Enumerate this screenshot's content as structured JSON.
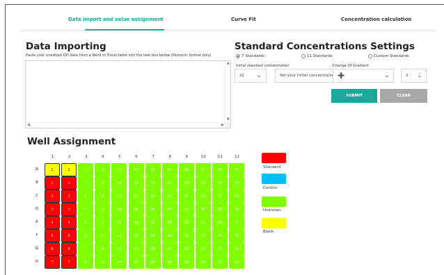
{
  "tabs": [
    {
      "label": "Data import and value assignment",
      "active": true
    },
    {
      "label": "Curve Fit",
      "active": false
    },
    {
      "label": "Concentration calculation",
      "active": false
    }
  ],
  "importing": {
    "title": "Data Importing",
    "instructions": "Paste your unedited OD data from a Word or Excel table into the text box below (Numeric format only)",
    "textarea_value": ""
  },
  "settings": {
    "title": "Standard Concentrations Settings",
    "radios": [
      {
        "label": "7 Standards",
        "checked": true
      },
      {
        "label": "11 Standards",
        "checked": false
      },
      {
        "label": "Custom Standards",
        "checked": false
      }
    ],
    "initial_label": "Initial standard concentration",
    "multiplier_value": "x1",
    "concentration_placeholder": "Set your initial concentration!",
    "gradient_label": "Change Of Gradient",
    "gradient_op": "✚",
    "gradient_value": "2",
    "submit_label": "SUBMIT",
    "clear_label": "CLEAR"
  },
  "well": {
    "title": "Well Assignment",
    "columns": [
      "1",
      "2",
      "3",
      "4",
      "5",
      "6",
      "7",
      "8",
      "9",
      "10",
      "11",
      "12"
    ],
    "rows": [
      {
        "label": "A",
        "cells": [
          "1",
          "1",
          "1",
          "9",
          "17",
          "25",
          "33",
          "41",
          "49",
          "57",
          "65",
          "73"
        ],
        "colors": [
          "Y",
          "Y",
          "G",
          "G",
          "G",
          "G",
          "G",
          "G",
          "G",
          "G",
          "G",
          "G"
        ]
      },
      {
        "label": "B",
        "cells": [
          "1",
          "1",
          "2",
          "10",
          "18",
          "26",
          "34",
          "42",
          "50",
          "58",
          "66",
          "74"
        ],
        "colors": [
          "R",
          "R",
          "G",
          "G",
          "G",
          "G",
          "G",
          "G",
          "G",
          "G",
          "G",
          "G"
        ]
      },
      {
        "label": "C",
        "cells": [
          "2",
          "2",
          "3",
          "11",
          "19",
          "27",
          "35",
          "43",
          "51",
          "59",
          "67",
          "75"
        ],
        "colors": [
          "R",
          "R",
          "G",
          "G",
          "G",
          "G",
          "G",
          "G",
          "G",
          "G",
          "G",
          "G"
        ]
      },
      {
        "label": "D",
        "cells": [
          "3",
          "3",
          "4",
          "12",
          "20",
          "28",
          "36",
          "44",
          "52",
          "60",
          "68",
          "76"
        ],
        "colors": [
          "R",
          "R",
          "G",
          "G",
          "G",
          "G",
          "G",
          "G",
          "G",
          "G",
          "G",
          "G"
        ]
      },
      {
        "label": "E",
        "cells": [
          "4",
          "4",
          "5",
          "13",
          "21",
          "29",
          "37",
          "45",
          "53",
          "61",
          "69",
          "77"
        ],
        "colors": [
          "R",
          "R",
          "G",
          "G",
          "G",
          "G",
          "G",
          "G",
          "G",
          "G",
          "G",
          "G"
        ]
      },
      {
        "label": "F",
        "cells": [
          "5",
          "5",
          "6",
          "14",
          "22",
          "30",
          "38",
          "46",
          "54",
          "62",
          "70",
          "78"
        ],
        "colors": [
          "R",
          "R",
          "G",
          "G",
          "G",
          "G",
          "G",
          "G",
          "G",
          "G",
          "G",
          "G"
        ]
      },
      {
        "label": "G",
        "cells": [
          "6",
          "6",
          "7",
          "15",
          "23",
          "31",
          "39",
          "47",
          "55",
          "63",
          "71",
          "79"
        ],
        "colors": [
          "R",
          "R",
          "G",
          "G",
          "G",
          "G",
          "G",
          "G",
          "G",
          "G",
          "G",
          "G"
        ]
      },
      {
        "label": "H",
        "cells": [
          "7",
          "7",
          "8",
          "16",
          "24",
          "32",
          "40",
          "48",
          "56",
          "64",
          "72",
          "80"
        ],
        "colors": [
          "R",
          "R",
          "G",
          "G",
          "G",
          "G",
          "G",
          "G",
          "G",
          "G",
          "G",
          "G"
        ]
      }
    ]
  },
  "legend": [
    {
      "label": "Standard",
      "color": "#ff0000"
    },
    {
      "label": "Control",
      "color": "#00bfff"
    },
    {
      "label": "Unknown",
      "color": "#80ff00"
    },
    {
      "label": "Blank",
      "color": "#ffff00"
    }
  ],
  "colors": {
    "accent": "#1aa89a",
    "submit": "#1aa89a",
    "clear": "#a8a8a8"
  }
}
